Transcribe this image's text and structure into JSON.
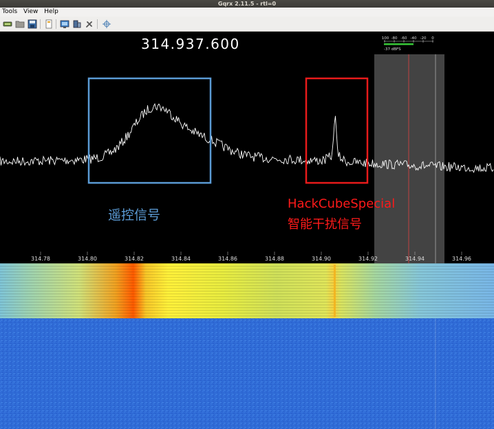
{
  "window": {
    "title": "Gqrx 2.11.5 - rtl=0"
  },
  "menu": {
    "tools": "Tools",
    "view": "View",
    "help": "Help"
  },
  "toolbar": {
    "icons": [
      "device-icon",
      "open-icon",
      "save-icon",
      "document-icon",
      "display-icon",
      "tools-icon",
      "wrench-icon",
      "crosshair-icon"
    ]
  },
  "plotter": {
    "frequency_readout": "314.937.600",
    "smeter": {
      "scale_labels": [
        "-100",
        "-80",
        "-60",
        "-40",
        "-20",
        "0"
      ],
      "level_text": "-37 dBFS"
    },
    "freq_axis": {
      "labels": [
        "314.78",
        "314.80",
        "314.82",
        "314.84",
        "314.86",
        "314.88",
        "314.90",
        "314.92",
        "314.94",
        "314.96"
      ]
    }
  },
  "annotations": {
    "remote_signal": {
      "label": "遥控信号",
      "color": "#5b9bd5"
    },
    "jammer_signal": {
      "label_line1": "HackCubeSpecial",
      "label_line2": "智能干扰信号",
      "color": "#ff1a1a"
    }
  },
  "colors": {
    "background": "#000000",
    "trace": "#ffffff",
    "filter_band": "#6a6a6a",
    "waterfall_noise": "#2f6bd6"
  }
}
